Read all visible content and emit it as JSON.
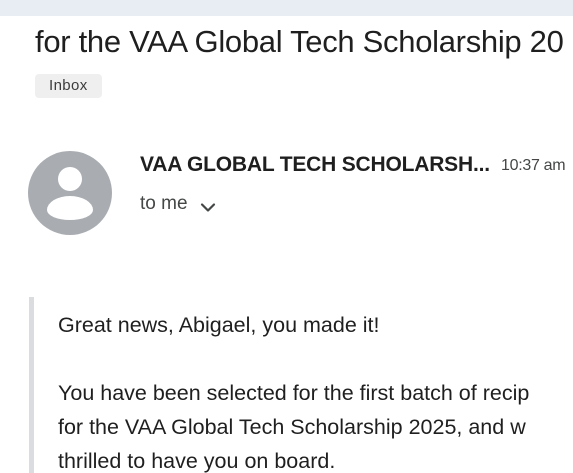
{
  "email": {
    "subject": "for the VAA Global Tech Scholarship 20",
    "label_badge": "Inbox",
    "sender_name": "VAA GLOBAL TECH SCHOLARSH...",
    "time": "10:37 am",
    "recipient_text": "to me",
    "body": {
      "line1": "Great news, Abigael, you made it!",
      "line2": "You have been selected for the first batch of recip",
      "line3": "for the VAA Global Tech Scholarship 2025, and w",
      "line4": "thrilled to have you on board."
    }
  },
  "icons": {
    "avatar": "person-avatar-icon",
    "expand": "chevron-down-icon"
  },
  "colors": {
    "top_bar": "#e8edf4",
    "avatar_bg": "#a9adb2",
    "badge_bg": "#efefef",
    "quote_bar": "#dadce0"
  }
}
